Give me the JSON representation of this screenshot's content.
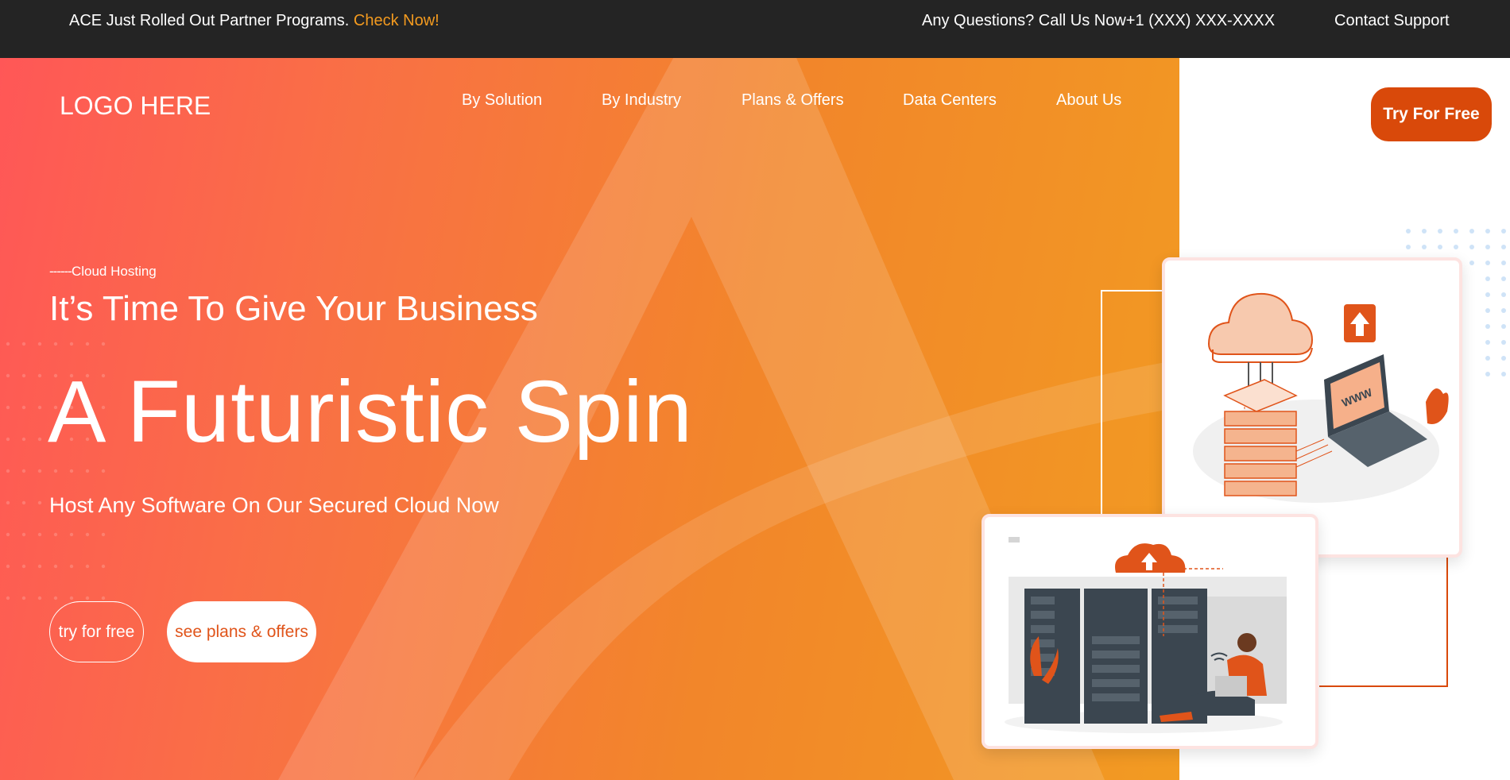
{
  "topbar": {
    "announcement": "ACE Just Rolled Out Partner Programs.",
    "announcement_link": "Check Now!",
    "phone": "Any Questions? Call Us Now+1 (XXX) XXX-XXXX",
    "support": "Contact Support"
  },
  "header": {
    "logo": "LOGO HERE",
    "nav": [
      "By Solution",
      "By Industry",
      "Plans & Offers",
      "Data Centers",
      "About Us"
    ],
    "cta": "Try For Free"
  },
  "hero": {
    "eyebrow_dash": "------",
    "eyebrow": "Cloud Hosting",
    "headline1": "It’s Time To Give Your Business",
    "headline2": "A Futuristic Spin",
    "subline": "Host Any Software On Our Secured Cloud Now",
    "btn_try": "try for free",
    "btn_plans": "see plans & offers"
  },
  "illustrations": {
    "laptop_text": "WWW"
  },
  "colors": {
    "accent": "#d9490a",
    "link": "#f39a1f",
    "topbar_bg": "#242424",
    "gradient_start": "#ff5757",
    "gradient_end": "#f29b22"
  },
  "icons": [
    "cloud-upload-icon",
    "upload-arrow-icon",
    "wifi-icon"
  ]
}
